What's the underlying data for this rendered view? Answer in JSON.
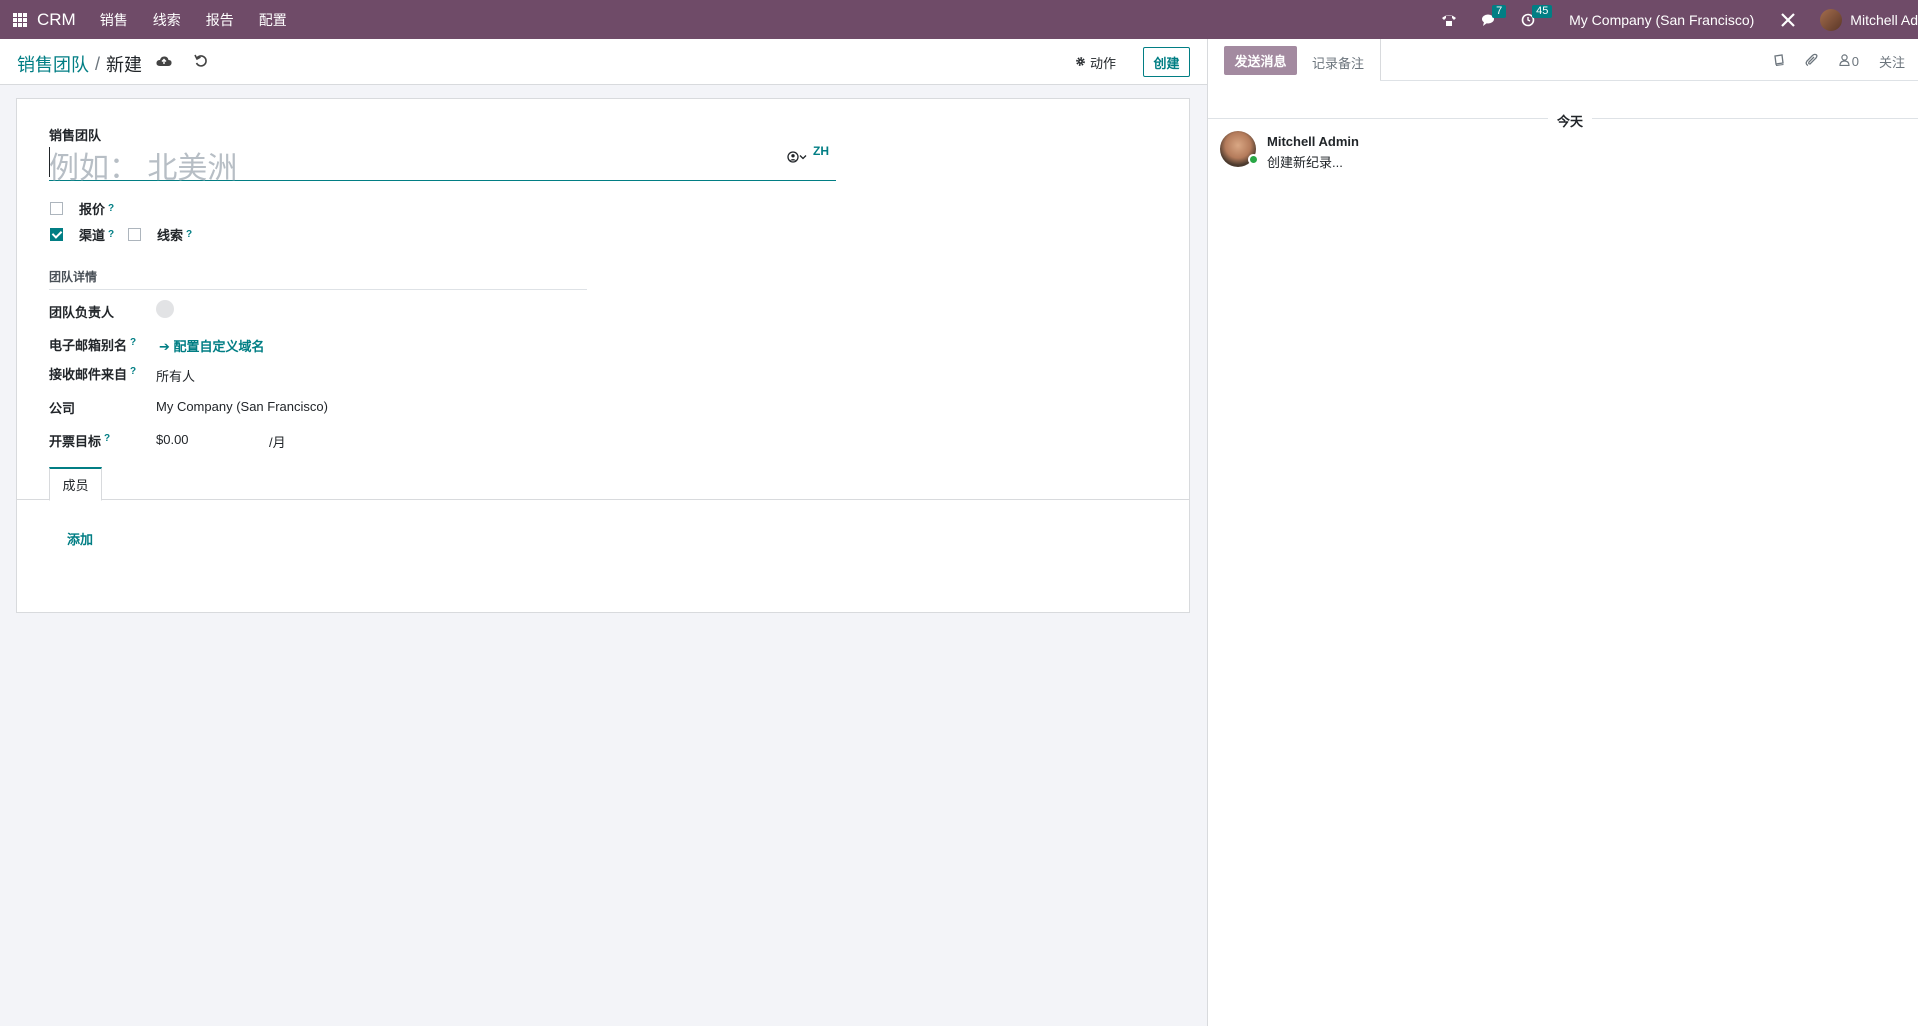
{
  "navbar": {
    "app_name": "CRM",
    "menu": [
      "销售",
      "线索",
      "报告",
      "配置"
    ],
    "messages_count": "7",
    "activities_count": "45",
    "company": "My Company (San Francisco)",
    "user": "Mitchell Ad"
  },
  "breadcrumb": {
    "parent": "销售团队",
    "separator": "/",
    "current": "新建"
  },
  "toolbar": {
    "action_label": "动作",
    "create_label": "创建"
  },
  "form": {
    "name_label": "销售团队",
    "name_placeholder": "例如： 北美洲",
    "lang": "ZH",
    "quotations_label": "报价",
    "pipeline_label": "渠道",
    "leads_label": "线索",
    "help_mark": "?",
    "section_title": "团队详情",
    "leader_label": "团队负责人",
    "alias_label": "电子邮箱别名",
    "alias_link": "配置自定义域名",
    "accept_from_label": "接收邮件来自",
    "accept_from_value": "所有人",
    "company_label": "公司",
    "company_value": "My Company (San Francisco)",
    "target_label": "开票目标",
    "target_value": "$0.00",
    "target_unit": "/月",
    "tab_members": "成员",
    "add_label": "添加"
  },
  "chatter": {
    "send_message": "发送消息",
    "log_note": "记录备注",
    "followers_count": "0",
    "follow_label": "关注",
    "day_label": "今天",
    "author": "Mitchell Admin",
    "body": "创建新纪录..."
  },
  "colors": {
    "navbar": "#6f4b68",
    "primary": "#017e84",
    "send_button": "#a38aa0"
  }
}
